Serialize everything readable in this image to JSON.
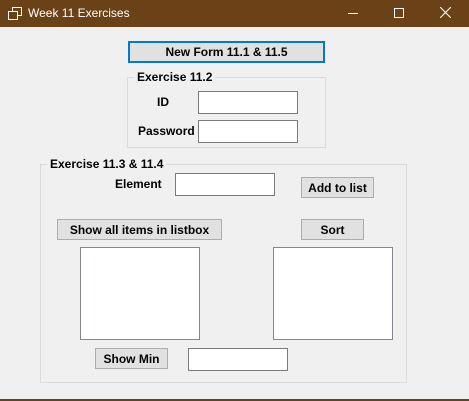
{
  "window": {
    "title": "Week 11 Exercises",
    "icons": {
      "app": "window-app-icon",
      "minimize": "minimize-icon",
      "maximize": "maximize-icon",
      "close": "close-icon"
    },
    "colors": {
      "titlebar": "#6b4218",
      "accent": "#0078d7",
      "client_background": "#f0f0f0"
    }
  },
  "buttons": {
    "new_form": "New Form 11.1 & 11.5",
    "add_to_list": "Add to list",
    "show_all": "Show all items in listbox",
    "sort": "Sort",
    "show_min": "Show Min"
  },
  "exercise_11_2": {
    "title": "Exercise 11.2",
    "id_label": "ID",
    "id_value": "",
    "password_label": "Password",
    "password_value": ""
  },
  "exercise_11_3": {
    "title": "Exercise 11.3 & 11.4",
    "element_label": "Element",
    "element_value": "",
    "min_value": "",
    "listbox_left_items": [],
    "listbox_right_items": []
  }
}
